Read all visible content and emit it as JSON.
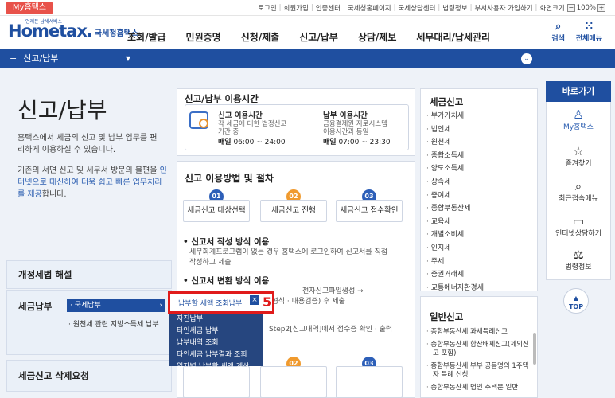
{
  "top": {
    "my_tab": "My홈택스",
    "links": [
      "로그인",
      "회원가입",
      "인증센터",
      "국세청홈페이지",
      "국세상담센터",
      "법령정보",
      "부서사용자 가입하기",
      "화면크기"
    ],
    "zoom_minus": "−",
    "zoom": "100%",
    "zoom_plus": "+"
  },
  "header": {
    "logo_tiny": "언제든 납세서비스",
    "logo_home": "Home",
    "logo_tax": "tax.",
    "logo_sub": "국세청홈택스",
    "gnb": [
      "조회/발급",
      "민원증명",
      "신청/제출",
      "신고/납부",
      "상담/제보",
      "세무대리/납세관리"
    ],
    "search_label": "검색",
    "all_menu_label": "전체메뉴"
  },
  "navbar": {
    "menu_icon": "≡",
    "current": "신고/납부",
    "arrow": "▼"
  },
  "left": {
    "title": "신고/납부",
    "desc1": "홈택스에서 세금의 신고 및 납부 업무를 편리하게 이용하실 수 있습니다.",
    "desc2_a": "기존의 서면 신고 및 세무서 방문의 불편을 ",
    "desc2_blue": "인터넷으로 대신하여 더욱 쉽고 빠른 업무처리를 제공",
    "desc2_b": "합니다.",
    "box1": "개정세법 해설",
    "box2": "세금납부",
    "box3": "세금신고 삭제요청",
    "sub_active": "· 국세납부",
    "sub_active_chev": "›",
    "sub2": "· 원천세 관련 지방소득세 납부"
  },
  "usage": {
    "title": "신고/납부 이용시간",
    "report_head": "신고 이용시간",
    "report_sub1": "각 세금에 대한 법정신고",
    "report_sub2": "기간 중",
    "report_daily": "매일",
    "report_time": "06:00 ~ 24:00",
    "pay_head": "납부 이용시간",
    "pay_sub1": "금융결제원 지로시스템",
    "pay_sub2": "이용시간과 동일",
    "pay_daily": "매일",
    "pay_time": "07:00 ~ 23:30"
  },
  "method": {
    "title": "신고 이용방법 및 절차",
    "steps": [
      {
        "num": "01",
        "label": "세금신고 대상선택"
      },
      {
        "num": "02",
        "label": "세금신고 진행"
      },
      {
        "num": "03",
        "label": "세금신고 접수확인"
      }
    ],
    "sec1_title": "• 신고서 작성 방식 이용",
    "sec1_text1": "세무회계프로그램이 없는 경우 홈택스에 로그인하여 신고서를 직접",
    "sec1_text2": "작성하고 제출",
    "sec2_title": "• 신고서 변환 방식 이용",
    "sec2_text1": "전자신고파일생성 →",
    "sec2_text2": "(형식 · 내용검증) 후 제출",
    "sec2_text3": "Step2[신고내역]에서 접수증 확인 · 출력",
    "bottom_nums": [
      "01",
      "02",
      "03"
    ]
  },
  "right_list": {
    "title": "세금신고",
    "items": [
      "부가가치세",
      "법인세",
      "원천세",
      "종합소득세",
      "양도소득세",
      "상속세",
      "증여세",
      "종합부동산세",
      "교육세",
      "개별소비세",
      "인지세",
      "주세",
      "증권거래세",
      "교통에너지환경세"
    ]
  },
  "right_list2": {
    "title": "일반신고",
    "items": [
      "종합부동산세 과세특례신고",
      "종합부동산세 합산배제신고(제외신고 포함)",
      "종합부동산세 부부 공동명의 1주택자 특례 신청",
      "종합부동산세 법인 주택분 일반"
    ]
  },
  "quick": {
    "title": "바로가기",
    "items": [
      {
        "icon": "person-icon",
        "glyph": "♙",
        "label": "My홈택스"
      },
      {
        "icon": "star-icon",
        "glyph": "☆",
        "label": "즐겨찾기"
      },
      {
        "icon": "history-icon",
        "glyph": "⌕",
        "label": "최근접속메뉴"
      },
      {
        "icon": "monitor-icon",
        "glyph": "▭",
        "label": "인터넷상담하기"
      },
      {
        "icon": "gavel-icon",
        "glyph": "⚖",
        "label": "법령정보"
      }
    ],
    "top_arrow": "▲",
    "top_label": "TOP"
  },
  "dropdown": {
    "highlight": "납부할 세액 조회납부",
    "close": "×",
    "items": [
      "자진납부",
      "타인세금 납부",
      "납부내역 조회",
      "타인세금 납부결과 조회",
      "일자별 납부할 세액 계산"
    ],
    "marker": "5"
  }
}
